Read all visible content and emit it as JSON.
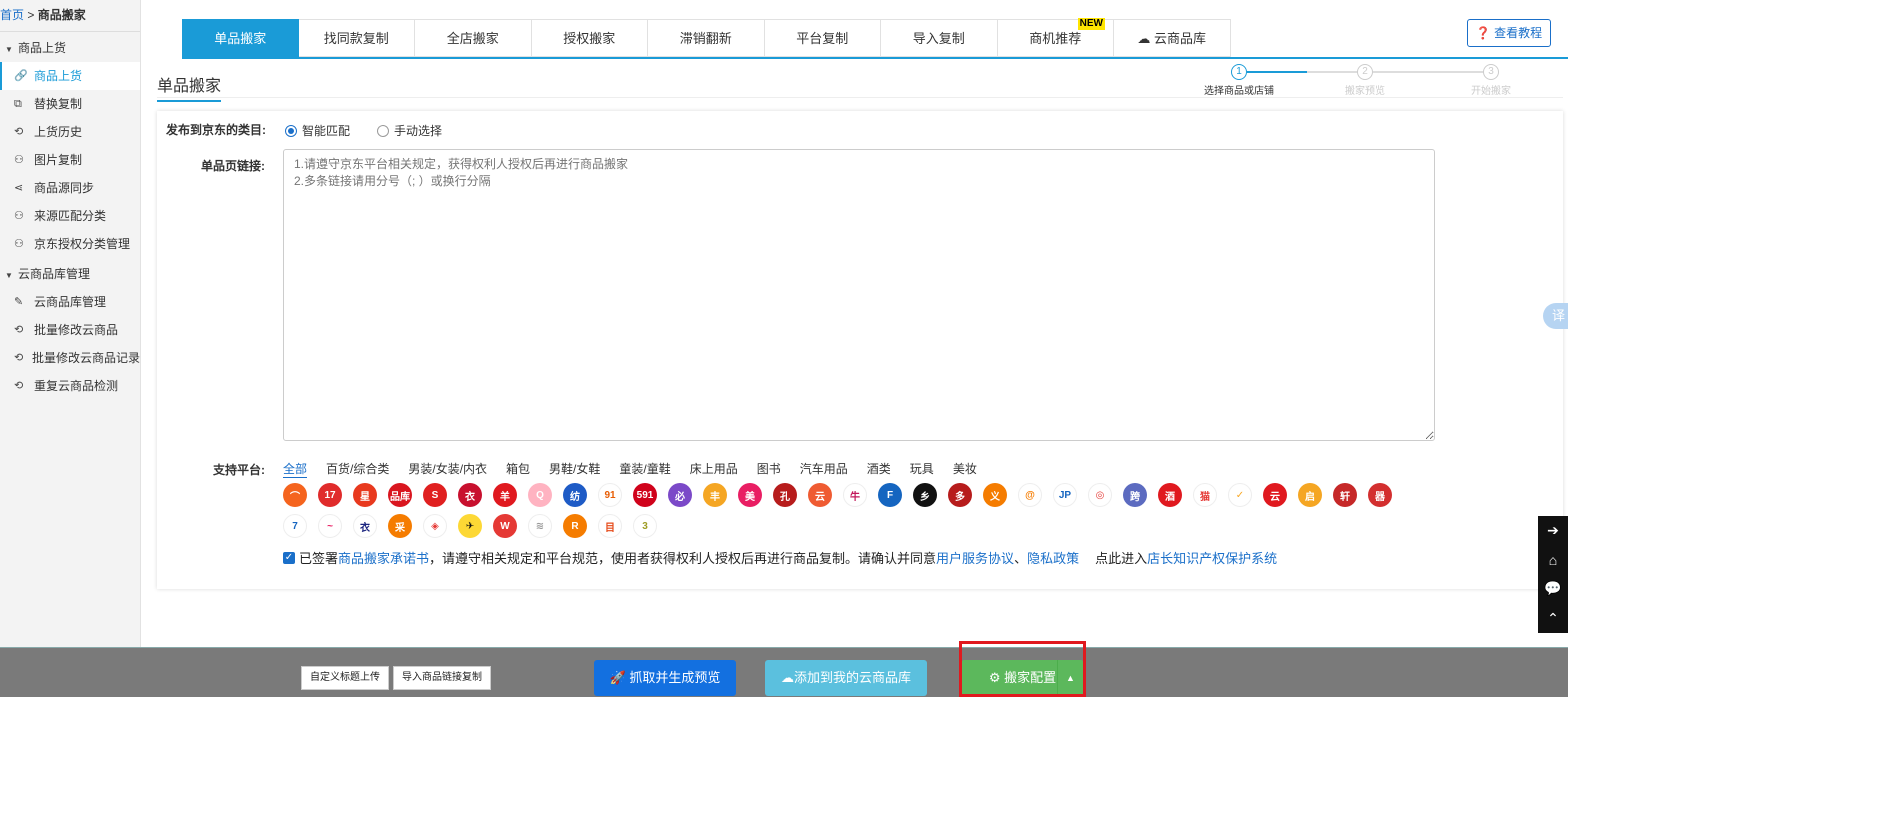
{
  "breadcrumb": {
    "home": "首页",
    "sep": " > ",
    "current": "商品搬家"
  },
  "sidebar": {
    "groups": [
      {
        "label": "商品上货",
        "items": [
          {
            "icon": "link-icon",
            "glyph": "🔗",
            "label": "商品上货"
          },
          {
            "icon": "copy-icon",
            "glyph": "⧉",
            "label": "替换复制"
          },
          {
            "icon": "history-icon",
            "glyph": "⟲",
            "label": "上货历史"
          },
          {
            "icon": "sitemap-icon",
            "glyph": "⚇",
            "label": "图片复制"
          },
          {
            "icon": "share-icon",
            "glyph": "⋖",
            "label": "商品源同步"
          },
          {
            "icon": "sitemap-icon",
            "glyph": "⚇",
            "label": "来源匹配分类"
          },
          {
            "icon": "sitemap-icon",
            "glyph": "⚇",
            "label": "京东授权分类管理"
          }
        ]
      },
      {
        "label": "云商品库管理",
        "items": [
          {
            "icon": "edit-icon",
            "glyph": "✎",
            "label": "云商品库管理"
          },
          {
            "icon": "history-icon",
            "glyph": "⟲",
            "label": "批量修改云商品"
          },
          {
            "icon": "history-icon",
            "glyph": "⟲",
            "label": "批量修改云商品记录"
          },
          {
            "icon": "history-icon",
            "glyph": "⟲",
            "label": "重复云商品检测"
          }
        ]
      }
    ]
  },
  "tabs": [
    {
      "label": "单品搬家",
      "active": true
    },
    {
      "label": "找同款复制"
    },
    {
      "label": "全店搬家"
    },
    {
      "label": "授权搬家"
    },
    {
      "label": "滞销翻新"
    },
    {
      "label": "平台复制"
    },
    {
      "label": "导入复制"
    },
    {
      "label": "商机推荐",
      "badge": "NEW"
    },
    {
      "label": "云商品库",
      "icon": "cloud-icon"
    }
  ],
  "help_button": "查看教程",
  "page_title": "单品搬家",
  "steps": [
    {
      "num": "1",
      "label": "选择商品或店铺"
    },
    {
      "num": "2",
      "label": "搬家预览"
    },
    {
      "num": "3",
      "label": "开始搬家"
    }
  ],
  "form": {
    "category_label": "发布到京东的类目:",
    "radio_smart": "智能匹配",
    "radio_manual": "手动选择",
    "link_label": "单品页链接:",
    "link_placeholder": "1.请遵守京东平台相关规定，获得权利人授权后再进行商品搬家\n2.多条链接请用分号（; ）或换行分隔",
    "platform_label": "支持平台:",
    "categories": [
      "全部",
      "百货/综合类",
      "男装/女装/内衣",
      "箱包",
      "男鞋/女鞋",
      "童装/童鞋",
      "床上用品",
      "图书",
      "汽车用品",
      "酒类",
      "玩具",
      "美妆"
    ],
    "platform_logos": [
      {
        "t": "⌒",
        "c": "#f5641e"
      },
      {
        "t": "17",
        "c": "#e02b2b"
      },
      {
        "t": "星",
        "c": "#e8391e"
      },
      {
        "t": "品库",
        "c": "#d9161f"
      },
      {
        "t": "S",
        "c": "#e02020"
      },
      {
        "t": "衣",
        "c": "#c8102e"
      },
      {
        "t": "羊",
        "c": "#e0191f"
      },
      {
        "t": "Q",
        "c": "#ffb3c1"
      },
      {
        "t": "纺",
        "c": "#1e5bc6"
      },
      {
        "t": "91",
        "c": "#ffffff",
        "fg": "#e85d04"
      },
      {
        "t": "591",
        "c": "#d0021b"
      },
      {
        "t": "必",
        "c": "#7b49c8"
      },
      {
        "t": "丰",
        "c": "#f5a623"
      },
      {
        "t": "美",
        "c": "#e91e63"
      },
      {
        "t": "孔",
        "c": "#b71c1c"
      },
      {
        "t": "云",
        "c": "#ef5b32"
      },
      {
        "t": "牛",
        "c": "#ffffff",
        "fg": "#c2185b"
      },
      {
        "t": "F",
        "c": "#1565c0"
      },
      {
        "t": "乡",
        "c": "#111111"
      },
      {
        "t": "多",
        "c": "#b71c1c"
      },
      {
        "t": "义",
        "c": "#f57c00"
      },
      {
        "t": "@",
        "c": "#ffffff",
        "fg": "#f57c00"
      },
      {
        "t": "JP",
        "c": "#ffffff",
        "fg": "#1565c0"
      },
      {
        "t": "◎",
        "c": "#ffffff",
        "fg": "#e53935"
      },
      {
        "t": "跨",
        "c": "#5c6bc0"
      },
      {
        "t": "酒",
        "c": "#e0191f"
      },
      {
        "t": "猫",
        "c": "#ffffff",
        "fg": "#e53935"
      },
      {
        "t": "✓",
        "c": "#ffffff",
        "fg": "#f9a825"
      },
      {
        "t": "云",
        "c": "#e0191f"
      },
      {
        "t": "启",
        "c": "#f5a623"
      },
      {
        "t": "轩",
        "c": "#c62828"
      },
      {
        "t": "器",
        "c": "#d32f2f"
      },
      {
        "t": "7",
        "c": "#ffffff",
        "fg": "#1565c0"
      },
      {
        "t": "~",
        "c": "#ffffff",
        "fg": "#e91e63"
      },
      {
        "t": "衣",
        "c": "#ffffff",
        "fg": "#1a237e"
      },
      {
        "t": "采",
        "c": "#f57c00"
      },
      {
        "t": "◈",
        "c": "#ffffff",
        "fg": "#e53935"
      },
      {
        "t": "✈",
        "c": "#fdd835",
        "fg": "#111111"
      },
      {
        "t": "W",
        "c": "#e53935"
      },
      {
        "t": "≋",
        "c": "#ffffff",
        "fg": "#999999"
      },
      {
        "t": "R",
        "c": "#f57c00"
      },
      {
        "t": "目",
        "c": "#ffffff",
        "fg": "#e64a19"
      },
      {
        "t": "3",
        "c": "#ffffff",
        "fg": "#9e9d24"
      }
    ],
    "agree_prefix": "已签署 ",
    "agree_link1": "商品搬家承诺书",
    "agree_mid": "，请遵守相关规定和平台规范，使用者获得权利人授权后再进行商品复制。请确认并同意",
    "agree_link2": "用户服务协议",
    "agree_sep": "、",
    "agree_link3": "隐私政策",
    "agree_enter": "点此进入",
    "agree_link4": "店长知识产权保护系统"
  },
  "translate_label": "译",
  "bottom": {
    "custom_title": "自定义标题上传",
    "import_links": "导入商品链接复制",
    "fetch_preview": "抓取并生成预览",
    "add_cloud": "添加到我的云商品库",
    "config": "搬家配置"
  },
  "colors": {
    "primary": "#1a9bd7",
    "link": "#1a6fc9",
    "fetch": "#1370e0",
    "cloud": "#5bc0de",
    "config": "#5cb85c",
    "highlight": "#e0191f"
  }
}
